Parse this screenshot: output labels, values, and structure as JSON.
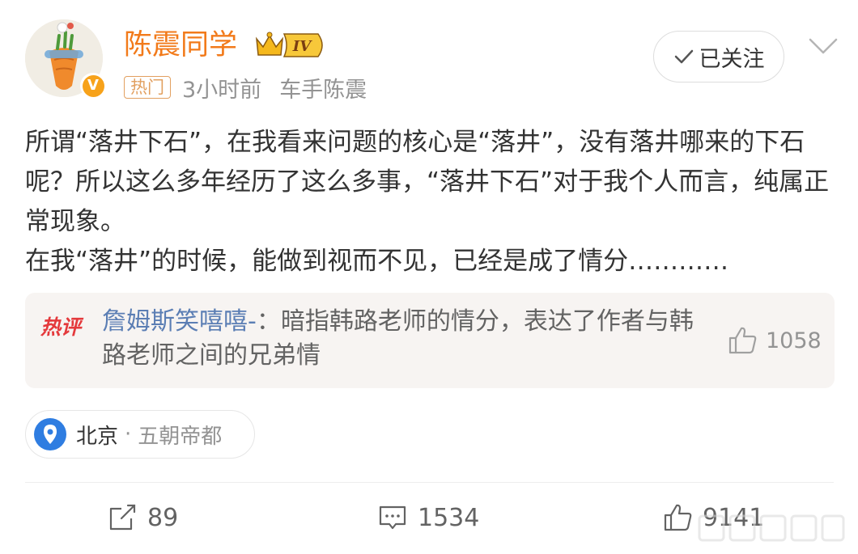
{
  "header": {
    "username": "陈震同学",
    "level_badge": "IV",
    "hot_tag": "热门",
    "time": "3小时前",
    "source": "车手陈震",
    "follow_label": "已关注"
  },
  "post": {
    "paragraphs": [
      "所谓“落井下石”，在我看来问题的核心是“落井”，没有落井哪来的下石呢？所以这么多年经历了这么多事，“落井下石”对于我个人而言，纯属正常现象。",
      "在我“落井”的时候，能做到视而不见，已经是成了情分…………"
    ]
  },
  "hot_comment": {
    "label": "热评",
    "user": "詹姆斯笑嘻嘻-",
    "separator": "：",
    "text": "暗指韩路老师的情分，表达了作者与韩路老师之间的兄弟情",
    "likes": "1058"
  },
  "location": {
    "city": "北京",
    "separator": "·",
    "description": "五朝帝都"
  },
  "actions": {
    "reposts": "89",
    "comments": "1534",
    "likes": "9141"
  },
  "colors": {
    "username": "#f27a1a",
    "comment_user": "#5b7eb4",
    "hot_label": "#e4393c",
    "location_pin": "#2f7de1",
    "verified": "#f7a21a"
  },
  "icons": {
    "avatar": "carrot-avatar",
    "verified": "verified-v-icon",
    "follow": "check-icon",
    "more": "chevron-down-icon",
    "comment_like": "thumbs-up-icon",
    "location": "location-pin-icon",
    "repost": "repost-icon",
    "comment": "comment-icon",
    "like": "thumbs-up-icon"
  }
}
